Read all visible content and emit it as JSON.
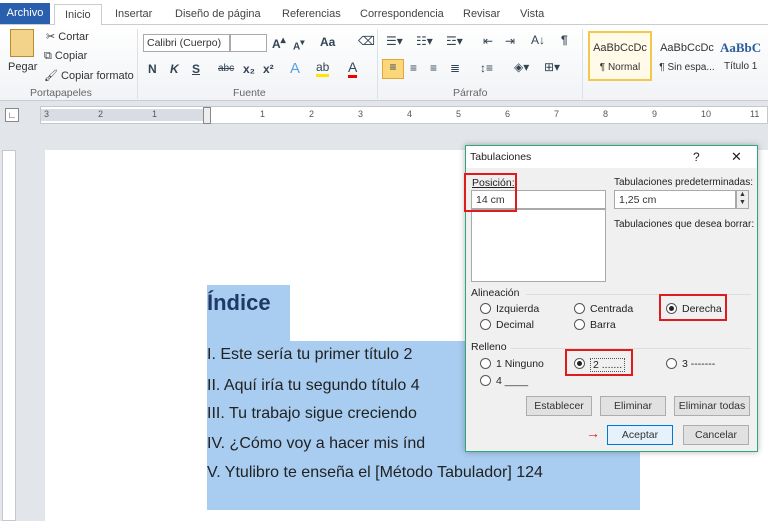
{
  "ribbon_tabs": [
    "Archivo",
    "Inicio",
    "Insertar",
    "Diseño de página",
    "Referencias",
    "Correspondencia",
    "Revisar",
    "Vista"
  ],
  "clipboard": {
    "paste": "Pegar",
    "cut": "Cortar",
    "copy": "Copiar",
    "format_painter": "Copiar formato",
    "group": "Portapapeles"
  },
  "font": {
    "name": "Calibri (Cuerpo)",
    "size": "",
    "group": "Fuente",
    "bold": "N",
    "italic": "K",
    "underline": "S",
    "strike": "abc",
    "sub": "x₂",
    "sup": "x²",
    "case": "Aa"
  },
  "paragraph": {
    "group": "Párrafo",
    "pilcrow": "¶"
  },
  "styles": [
    {
      "preview": "AaBbCcDc",
      "label": "¶ Normal"
    },
    {
      "preview": "AaBbCcDc",
      "label": "¶ Sin espa..."
    },
    {
      "preview": "AaBbC",
      "label": "Título 1"
    }
  ],
  "ruler_numbers": [
    "3",
    "2",
    "1",
    "1",
    "2",
    "3",
    "4",
    "5",
    "6",
    "7",
    "8",
    "9",
    "10",
    "11"
  ],
  "document": {
    "heading": "Índice",
    "lines": [
      "I. Este sería tu primer título 2",
      "II. Aquí iría tu segundo título 4",
      "III. Tu trabajo sigue creciendo",
      "IV. ¿Cómo voy a hacer mis índ",
      "V. Ytulibro te enseña el [Método Tabulador] 124"
    ]
  },
  "dialog": {
    "title": "Tabulaciones",
    "help": "?",
    "close": "✕",
    "position_label": "Posición:",
    "position_value": "14 cm",
    "default_label": "Tabulaciones predeterminadas:",
    "default_value": "1,25 cm",
    "clear_label": "Tabulaciones que desea borrar:",
    "alignment_label": "Alineación",
    "alignment": [
      "Izquierda",
      "Centrada",
      "Derecha",
      "Decimal",
      "Barra"
    ],
    "alignment_selected": "Derecha",
    "fill_label": "Relleno",
    "fill": [
      "1 Ninguno",
      "2 .......",
      "3 -------",
      "4 ____"
    ],
    "fill_selected": "2 .......",
    "set": "Establecer",
    "clear": "Eliminar",
    "clear_all": "Eliminar todas",
    "ok": "Aceptar",
    "cancel": "Cancelar"
  },
  "colors": {
    "highlight": "#e01b1b",
    "selection": "#a8cdf0",
    "dialog_border": "#2fa67f",
    "file_tab": "#2a5fae"
  }
}
